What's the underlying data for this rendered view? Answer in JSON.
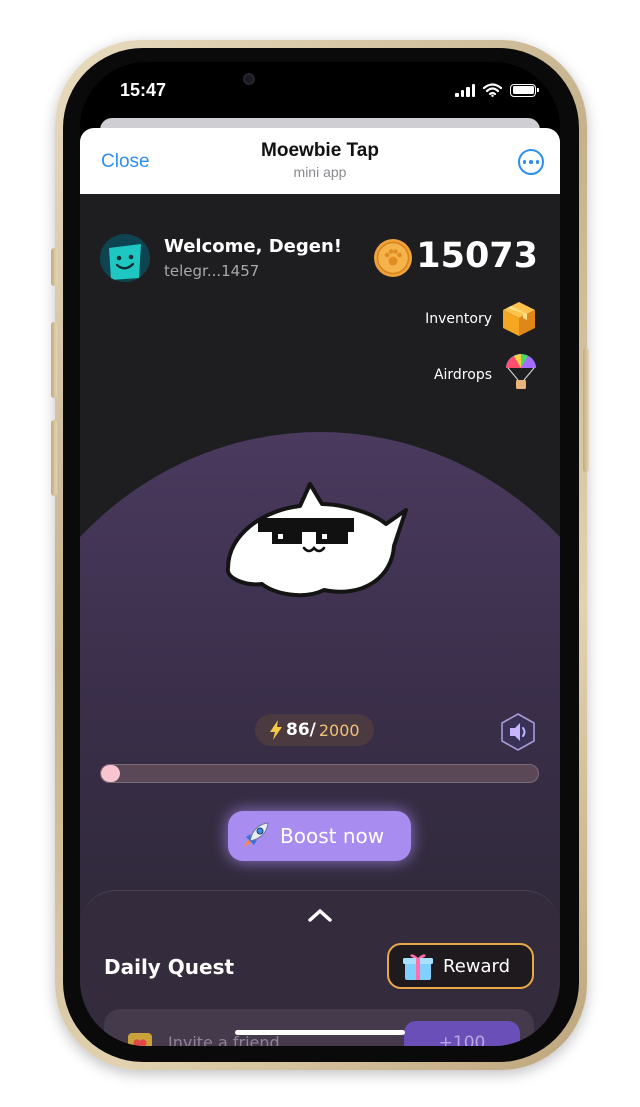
{
  "status_bar": {
    "time": "15:47"
  },
  "header": {
    "close_label": "Close",
    "title": "Moewbie Tap",
    "subtitle": "mini app"
  },
  "user": {
    "welcome": "Welcome, Degen!",
    "handle": "telegr...1457"
  },
  "balance": {
    "value": "15073"
  },
  "side_links": {
    "inventory_label": "Inventory",
    "airdrops_label": "Airdrops"
  },
  "energy": {
    "current": "86/",
    "max": "2000",
    "fraction": 0.043
  },
  "boost": {
    "label": "Boost now"
  },
  "quest": {
    "title": "Daily Quest",
    "reward_label": "Reward",
    "first_item_label": "Invite a friend",
    "first_item_reward": "+100"
  },
  "colors": {
    "accent_purple": "#a88cf0",
    "reward_border": "#e8a84a",
    "link_blue": "#2e8ff0",
    "app_bg": "#1e1e20"
  },
  "icons": [
    "shield-icon",
    "coin-icon",
    "box-icon",
    "parachute-icon",
    "rocket-icon",
    "speaker-icon",
    "gift-icon",
    "chevron-up-icon",
    "lightning-icon",
    "more-icon"
  ]
}
